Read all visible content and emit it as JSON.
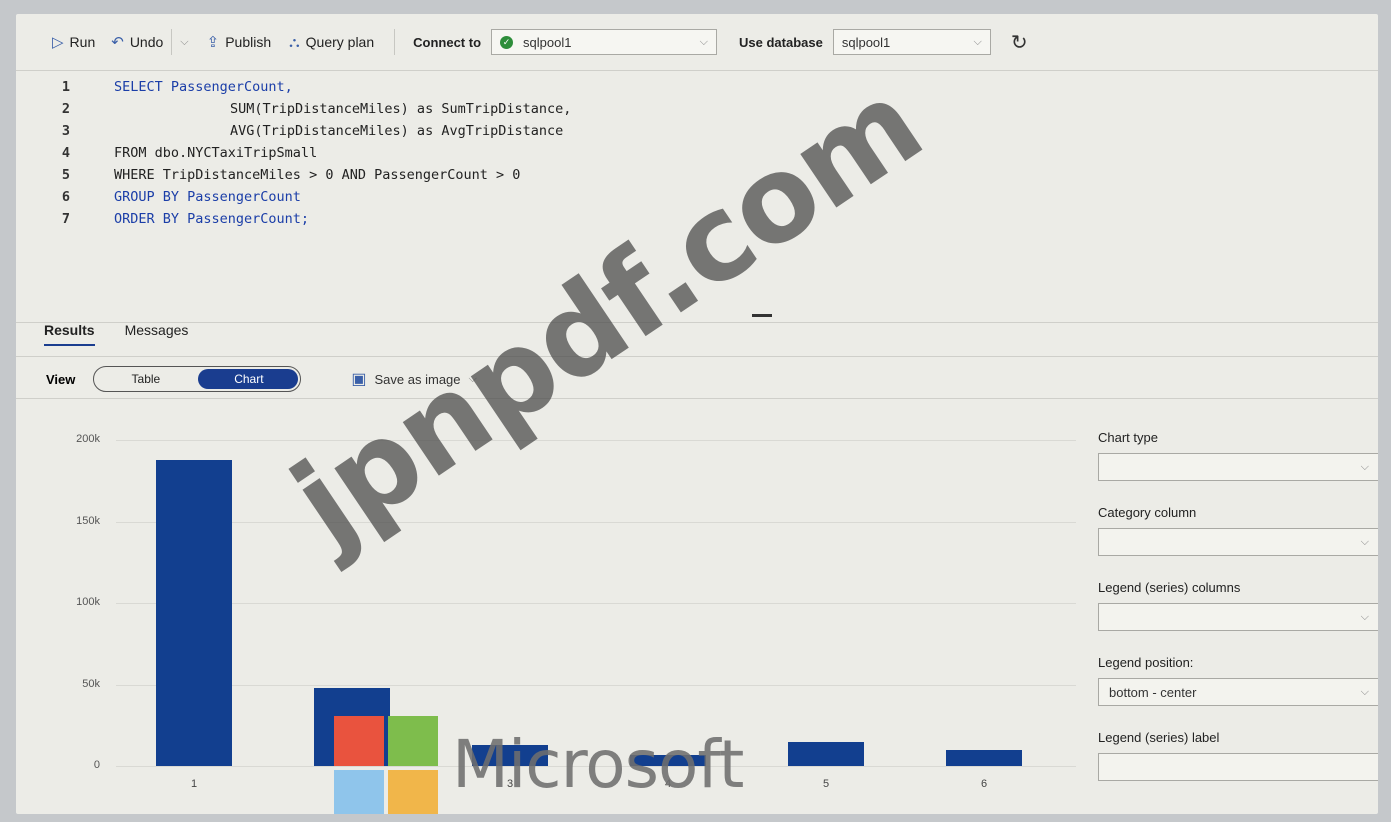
{
  "toolbar": {
    "run": "Run",
    "undo": "Undo",
    "publish": "Publish",
    "query_plan": "Query plan",
    "connect_to_label": "Connect to",
    "connect_to_value": "sqlpool1",
    "use_database_label": "Use database",
    "use_database_value": "sqlpool1"
  },
  "editor": {
    "lines": [
      {
        "n": "1",
        "text": "SELECT PassengerCount,"
      },
      {
        "n": "2",
        "text": "SUM(TripDistanceMiles) as SumTripDistance,"
      },
      {
        "n": "3",
        "text": "AVG(TripDistanceMiles) as AvgTripDistance"
      },
      {
        "n": "4",
        "text": "FROM  dbo.NYCTaxiTripSmall"
      },
      {
        "n": "5",
        "text": "WHERE TripDistanceMiles > 0 AND PassengerCount > 0"
      },
      {
        "n": "6",
        "text": "GROUP BY PassengerCount"
      },
      {
        "n": "7",
        "text": "ORDER BY PassengerCount;"
      }
    ]
  },
  "results": {
    "tabs": [
      "Results",
      "Messages"
    ],
    "view_label": "View",
    "view_options": [
      "Table",
      "Chart"
    ],
    "selected_view": "Chart",
    "save_as_image": "Save as image"
  },
  "chart_data": {
    "type": "bar",
    "categories": [
      "1",
      "2",
      "3",
      "4",
      "5",
      "6"
    ],
    "values": [
      188000,
      48000,
      13000,
      7000,
      15000,
      10000
    ],
    "ylim": [
      0,
      200000
    ],
    "yticks": [
      "0",
      "50k",
      "100k",
      "150k",
      "200k"
    ],
    "bar_color": "#123f8f"
  },
  "chart_settings": {
    "chart_type_label": "Chart type",
    "chart_type_value": "",
    "category_column_label": "Category column",
    "category_column_value": "",
    "legend_columns_label": "Legend (series) columns",
    "legend_columns_value": "",
    "legend_position_label": "Legend position:",
    "legend_position_value": "bottom - center",
    "legend_label_label": "Legend (series) label",
    "legend_label_value": ""
  },
  "watermarks": {
    "site": "jpnpdf.com",
    "brand": "Microsoft"
  }
}
